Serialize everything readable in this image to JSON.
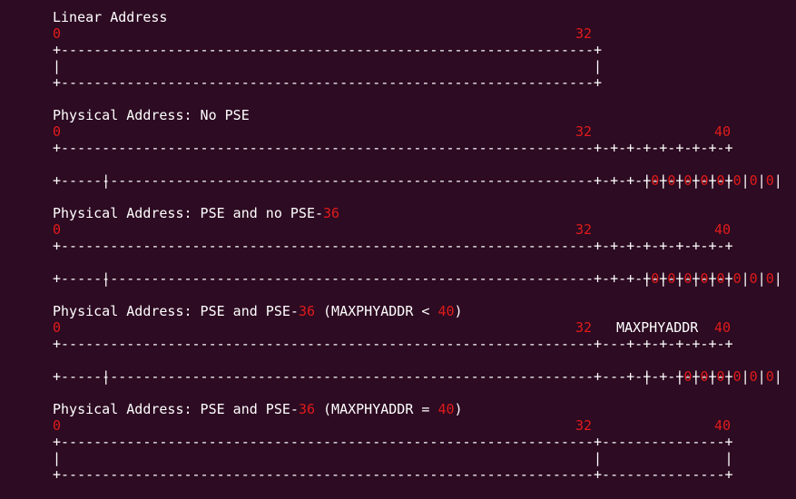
{
  "sections": [
    {
      "title": {
        "prefix": "Linear Address",
        "num": "",
        "mid": "",
        "num2": "",
        "suffix": ""
      },
      "ruler": {
        "start": "0",
        "mid": "32",
        "mid_extra": "",
        "end": ""
      },
      "top_border": "+-----------------------------------------------------------------+",
      "body_line": "|                                                                 |",
      "bottom_border": "+-----------------------------------------------------------------+"
    },
    {
      "title": {
        "prefix": "Physical Address: No PSE",
        "num": "",
        "mid": "",
        "num2": "",
        "suffix": ""
      },
      "ruler": {
        "start": "0",
        "mid": "32",
        "mid_extra": "",
        "end": "40"
      },
      "top_border": "+-----------------------------------------------------------------+-+-+-+-+-+-+-+-+",
      "body_line": "|                                                                 |",
      "bits": [
        "0",
        "0",
        "0",
        "0",
        "0",
        "0",
        "0",
        "0"
      ],
      "bottom_border": "+-----------------------------------------------------------------+-+-+-+-+-+-+-+-+"
    },
    {
      "title": {
        "prefix": "Physical Address: PSE and no PSE-",
        "num": "36",
        "mid": "",
        "num2": "",
        "suffix": ""
      },
      "ruler": {
        "start": "0",
        "mid": "32",
        "mid_extra": "",
        "end": "40"
      },
      "top_border": "+-----------------------------------------------------------------+-+-+-+-+-+-+-+-+",
      "body_line": "|                                                                 |",
      "bits": [
        "0",
        "0",
        "0",
        "0",
        "0",
        "0",
        "0",
        "0"
      ],
      "bottom_border": "+-----------------------------------------------------------------+-+-+-+-+-+-+-+-+"
    },
    {
      "title": {
        "prefix": "Physical Address: PSE and PSE-",
        "num": "36",
        "mid": " (MAXPHYADDR < ",
        "num2": "40",
        "suffix": ")"
      },
      "ruler": {
        "start": "0",
        "mid": "32",
        "mid_extra": "MAXPHYADDR",
        "end": "40"
      },
      "top_border": "+-----------------------------------------------------------------+---+-+-+-+-+-+-+",
      "body_line": "|                                                                 |   |",
      "bits": [
        "0",
        "0",
        "0",
        "0",
        "0",
        "0"
      ],
      "bottom_border": "+-----------------------------------------------------------------+---+-+-+-+-+-+-+"
    },
    {
      "title": {
        "prefix": "Physical Address: PSE and PSE-",
        "num": "36",
        "mid": " (MAXPHYADDR = ",
        "num2": "40",
        "suffix": ")"
      },
      "ruler": {
        "start": "0",
        "mid": "32",
        "mid_extra": "",
        "end": "40"
      },
      "top_border": "+-----------------------------------------------------------------+---------------+",
      "body_line": "|                                                                 |               |",
      "bottom_border": "+-----------------------------------------------------------------+---------------+"
    }
  ]
}
